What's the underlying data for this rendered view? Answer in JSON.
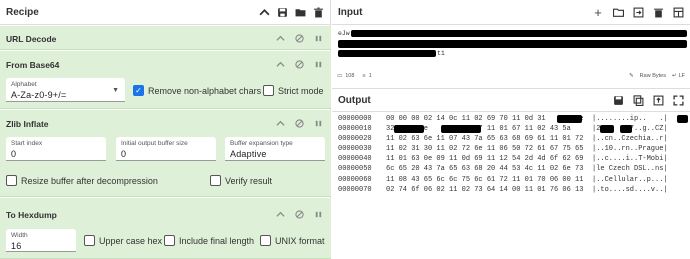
{
  "recipe": {
    "title": "Recipe",
    "operations": {
      "url_decode": {
        "title": "URL Decode"
      },
      "from_base64": {
        "title": "From Base64",
        "alphabet_label": "Alphabet",
        "alphabet_value": "A-Za-z0-9+/=",
        "remove_non_alpha_label": "Remove non-alphabet chars",
        "remove_non_alpha_checked": true,
        "strict_mode_label": "Strict mode",
        "strict_mode_checked": false
      },
      "zlib_inflate": {
        "title": "Zlib Inflate",
        "start_index_label": "Start index",
        "start_index_value": "0",
        "initial_buffer_label": "Initial output buffer size",
        "initial_buffer_value": "0",
        "buffer_expansion_label": "Buffer expansion type",
        "buffer_expansion_value": "Adaptive",
        "resize_label": "Resize buffer after decompression",
        "resize_checked": false,
        "verify_label": "Verify result",
        "verify_checked": false
      },
      "to_hexdump": {
        "title": "To Hexdump",
        "width_label": "Width",
        "width_value": "16",
        "upper_case_label": "Upper case hex",
        "upper_case_checked": false,
        "include_length_label": "Include final length",
        "include_length_checked": false,
        "unix_format_label": "UNIX format",
        "unix_format_checked": false
      }
    }
  },
  "input": {
    "title": "Input",
    "line1_prefix": "eJw",
    "line3_suffix": "t1",
    "status_left_count": "108",
    "status_left_lines": "1",
    "raw_bytes": "Raw Bytes",
    "line_ending": "LF"
  },
  "output": {
    "title": "Output",
    "rows": [
      {
        "offset": "00000000",
        "hex": "00 00 00 02 14 0c 11 02 69 70 11 0d 31       2e",
        "ascii": "|........ip..   .|"
      },
      {
        "offset": "00000010",
        "hex": "32      2e        2e 37 11 01 67 11 02 43 5a",
        "ascii": "|2  .   .7..g..CZ|"
      },
      {
        "offset": "00000020",
        "hex": "11 02 63 6e 11 07 43 7a 65 63 68 69 61 11 01 72",
        "ascii": "|..cn..Czechia..r|"
      },
      {
        "offset": "00000030",
        "hex": "11 02 31 30 11 02 72 6e 11 06 50 72 61 67 75 65",
        "ascii": "|..10..rn..Prague|"
      },
      {
        "offset": "00000040",
        "hex": "11 01 63 0e 09 11 0d 69 11 12 54 2d 4d 6f 62 69",
        "ascii": "|..c....i..T-Mobi|"
      },
      {
        "offset": "00000050",
        "hex": "6c 65 20 43 7a 65 63 68 20 44 53 4c 11 02 6e 73",
        "ascii": "|le Czech DSL..ns|"
      },
      {
        "offset": "00000060",
        "hex": "11 08 43 65 6c 6c 75 6c 61 72 11 01 70 06 00 11",
        "ascii": "|..Cellular..p...|"
      },
      {
        "offset": "00000070",
        "hex": "02 74 6f 06 02 11 02 73 64 14 00 11 01 76 06 13",
        "ascii": "|.to....sd....v..|"
      }
    ]
  },
  "colors": {
    "operation_bg": "#dff0d8",
    "checkbox_on": "#1a73e8"
  }
}
